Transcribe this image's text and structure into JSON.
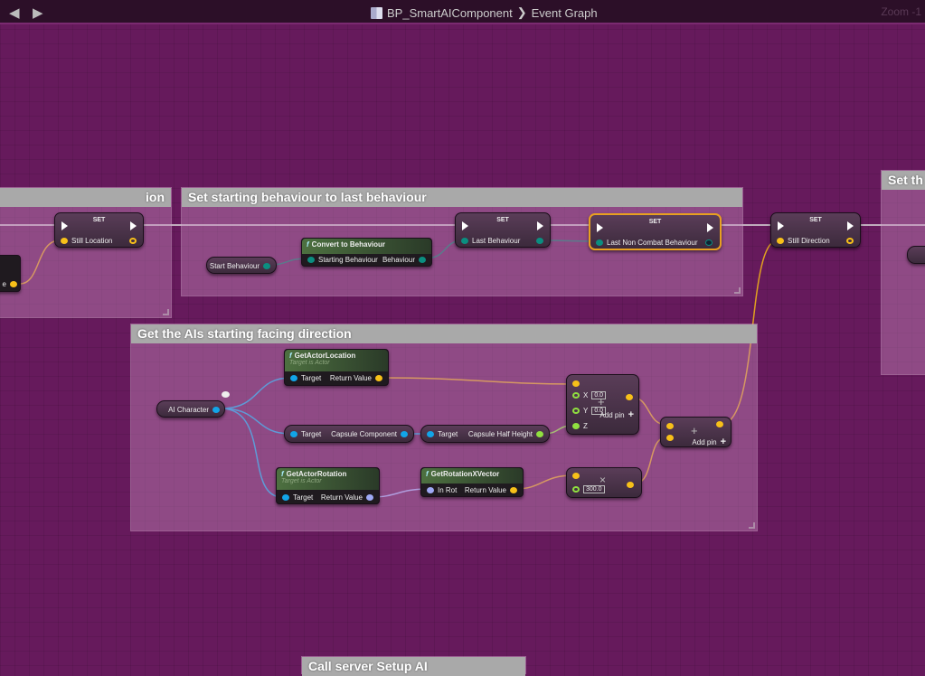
{
  "toolbar": {
    "back": "back-arrow",
    "forward": "forward-arrow",
    "blueprint": "BP_SmartAIComponent",
    "separator": "❯",
    "graph": "Event Graph",
    "zoom": "Zoom -1"
  },
  "comments": [
    {
      "title": "ion"
    },
    {
      "title": "Set starting behaviour to last behaviour"
    },
    {
      "title": "Get the AIs starting facing direction"
    },
    {
      "title": "Set th"
    },
    {
      "title": "Call server Setup AI"
    }
  ],
  "nodes": {
    "partial_left_pin": "e",
    "set_label": "SET",
    "set_still_location": "Still Location",
    "start_behaviour": "Start Behaviour",
    "convert": {
      "title": "Convert to Behaviour",
      "in": "Starting Behaviour",
      "out": "Behaviour"
    },
    "set_last_behaviour": "Last Behaviour",
    "set_last_non_combat": "Last Non Combat Behaviour",
    "set_still_direction": "Still Direction",
    "ai_character": "AI Character",
    "get_actor_location": {
      "title": "GetActorLocation",
      "sub": "Target is Actor",
      "in": "Target",
      "out": "Return Value"
    },
    "capsule": {
      "in": "Target",
      "out": "Capsule Component"
    },
    "half_height": {
      "in": "Target",
      "out": "Capsule Half Height"
    },
    "get_actor_rotation": {
      "title": "GetActorRotation",
      "sub": "Target is Actor",
      "in": "Target",
      "out": "Return Value"
    },
    "get_rot_x": {
      "title": "GetRotationXVector",
      "in": "In Rot",
      "out": "Return Value"
    },
    "make_add": {
      "x_label": "X",
      "x_val": "0.0",
      "y_label": "Y",
      "y_val": "0.0",
      "z_label": "Z",
      "add_pin": "Add pin",
      "op": "+"
    },
    "multiply": {
      "val": "300.0",
      "op": "×"
    },
    "add": {
      "add_pin": "Add pin",
      "op": "+"
    }
  },
  "colors": {
    "object": "#12a5e8",
    "vector": "#f7c019",
    "float": "#90e040",
    "byte": "#0b6e66",
    "rotator": "#9fa9f5",
    "exec": "#ffffff"
  }
}
